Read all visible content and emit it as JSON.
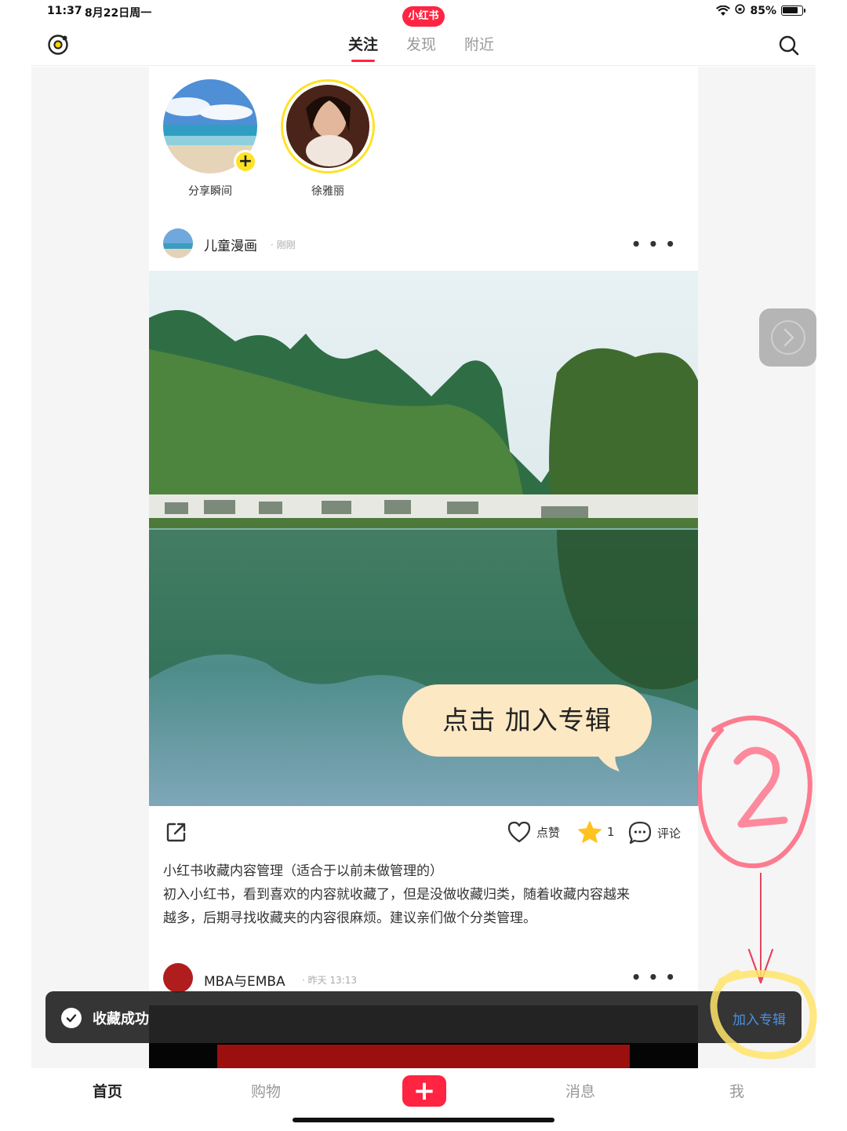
{
  "status_bar": {
    "time": "11:37",
    "date": "8月22日周一",
    "app_logo": "小红书",
    "battery": "85%",
    "battery_level": 0.85
  },
  "top_nav": {
    "tabs": [
      {
        "label": "关注",
        "active": true
      },
      {
        "label": "发现",
        "active": false
      },
      {
        "label": "附近",
        "active": false
      }
    ],
    "left_icon": "live-icon",
    "right_icon": "search-icon"
  },
  "stories": [
    {
      "name": "分享瞬间",
      "has_add": true
    },
    {
      "name": "徐雅丽",
      "has_add": false
    }
  ],
  "post": {
    "author": "儿童漫画",
    "time": "· 刚刚",
    "like_label": "点赞",
    "collect_count": "1",
    "comment_label": "评论",
    "text_lines": [
      "小红书收藏内容管理（适合于以前未做管理的）",
      "初入小红书，看到喜欢的内容就收藏了，但是没做收藏归类，随着收藏内容越来",
      "越多，后期寻找收藏夹的内容很麻烦。建议亲们做个分类管理。"
    ],
    "overlay_bubble": "点击 加入专辑"
  },
  "post2": {
    "author": "MBA与EMBA",
    "time": "· 昨天 13:13"
  },
  "toast": {
    "message": "收藏成功",
    "action": "加入专辑"
  },
  "annotation": {
    "number": "②",
    "circle_color": "#ff3b5c",
    "highlight_color": "#ffe46a"
  },
  "tab_bar": {
    "items": [
      "首页",
      "购物",
      "消息",
      "我"
    ],
    "active": "首页"
  },
  "colors": {
    "brand": "#ff2442",
    "accent_yellow": "#ffe225",
    "toast_link": "#4a90e2"
  }
}
